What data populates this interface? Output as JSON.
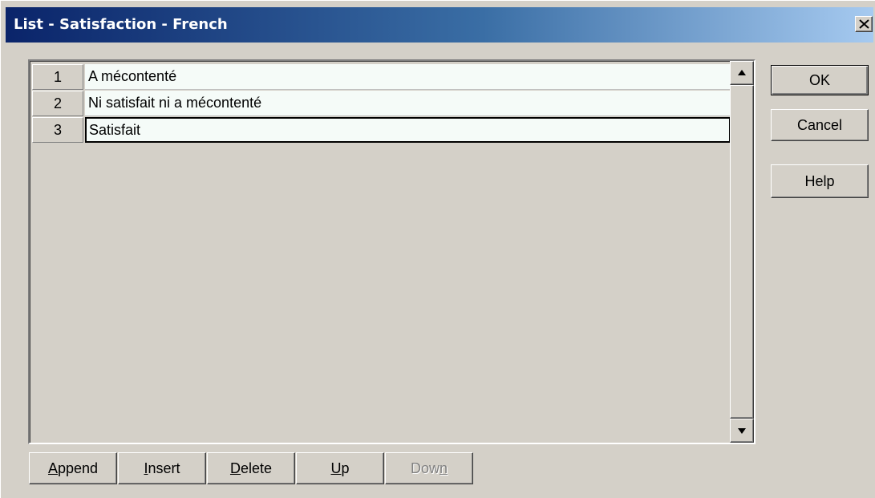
{
  "window": {
    "title": "List - Satisfaction - French"
  },
  "list": {
    "rows": [
      {
        "num": "1",
        "text": "A mécontenté"
      },
      {
        "num": "2",
        "text": "Ni satisfait ni a mécontenté"
      },
      {
        "num": "3",
        "text": "Satisfait"
      }
    ],
    "selected_row": 3
  },
  "side_buttons": {
    "ok": "OK",
    "cancel": "Cancel",
    "help": "Help"
  },
  "bottom_buttons": {
    "append": {
      "accel": "A",
      "rest": "ppend"
    },
    "insert": {
      "accel": "I",
      "rest": "nsert"
    },
    "delete": {
      "accel": "D",
      "rest": "elete"
    },
    "up": {
      "accel": "U",
      "rest": "p"
    },
    "down": {
      "pre": "Dow",
      "accel": "n"
    }
  },
  "colors": {
    "title_start": "#0a246a",
    "title_end": "#a6caf0",
    "face": "#d4d0c8",
    "cell_bg": "#f5fbf8",
    "disabled_text": "#808080"
  },
  "icons": {
    "close": "close-icon",
    "scroll_up": "scroll-up-arrow-icon",
    "scroll_down": "scroll-down-arrow-icon"
  }
}
